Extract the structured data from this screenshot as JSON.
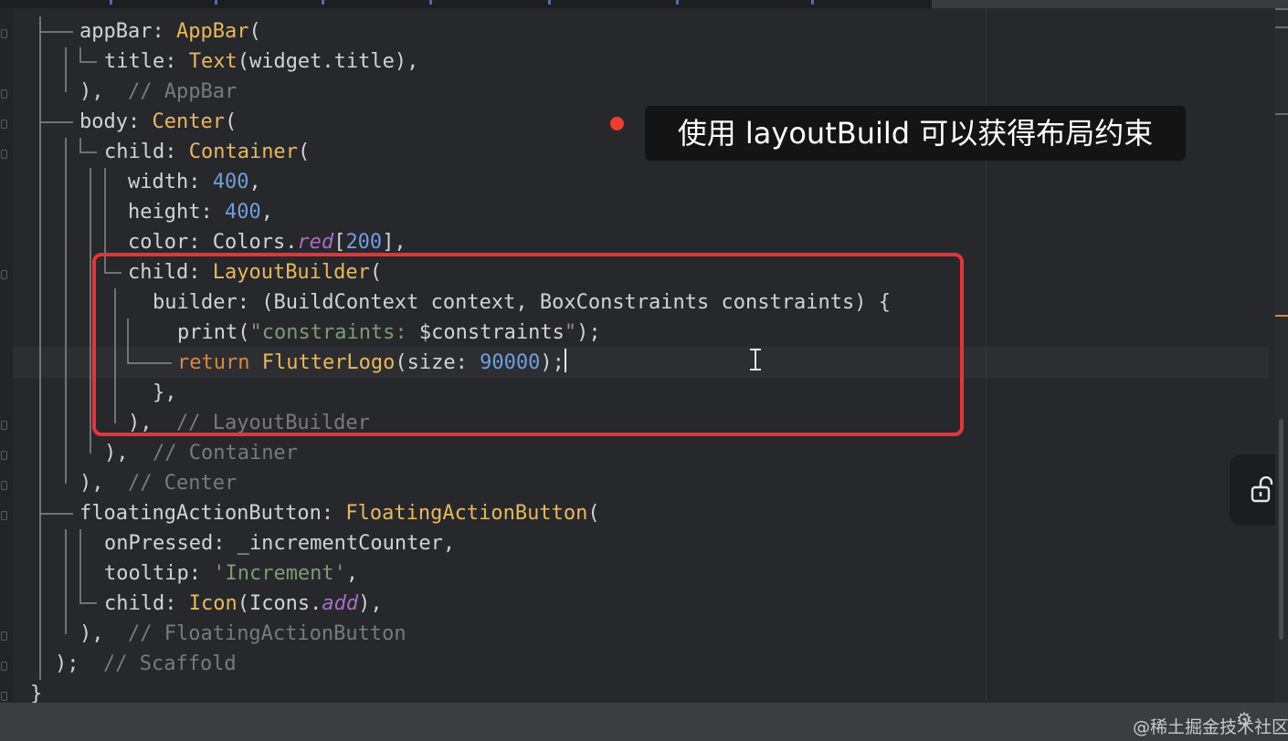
{
  "editor": {
    "lines": [
      [
        {
          "t": "appBar: ",
          "c": "k"
        },
        {
          "t": "AppBar",
          "c": "c"
        },
        {
          "t": "(",
          "c": "p"
        }
      ],
      [
        {
          "t": "title: ",
          "c": "k"
        },
        {
          "t": "Text",
          "c": "c"
        },
        {
          "t": "(",
          "c": "p"
        },
        {
          "t": "widget.title",
          "c": "k"
        },
        {
          "t": "),",
          "c": "p"
        }
      ],
      [
        {
          "t": "),  ",
          "c": "p"
        },
        {
          "t": "// AppBar",
          "c": "cm"
        }
      ],
      [
        {
          "t": "body: ",
          "c": "k"
        },
        {
          "t": "Center",
          "c": "c"
        },
        {
          "t": "(",
          "c": "p"
        }
      ],
      [
        {
          "t": "child: ",
          "c": "k"
        },
        {
          "t": "Container",
          "c": "c"
        },
        {
          "t": "(",
          "c": "p"
        }
      ],
      [
        {
          "t": "width: ",
          "c": "k"
        },
        {
          "t": "400",
          "c": "n"
        },
        {
          "t": ",",
          "c": "p"
        }
      ],
      [
        {
          "t": "height: ",
          "c": "k"
        },
        {
          "t": "400",
          "c": "n"
        },
        {
          "t": ",",
          "c": "p"
        }
      ],
      [
        {
          "t": "color: ",
          "c": "k"
        },
        {
          "t": "Colors.",
          "c": "k"
        },
        {
          "t": "red",
          "c": "i"
        },
        {
          "t": "[",
          "c": "p"
        },
        {
          "t": "200",
          "c": "n"
        },
        {
          "t": "],",
          "c": "p"
        }
      ],
      [
        {
          "t": "child: ",
          "c": "k"
        },
        {
          "t": "LayoutBuilder",
          "c": "c"
        },
        {
          "t": "(",
          "c": "p"
        }
      ],
      [
        {
          "t": "builder: (BuildContext context, BoxConstraints constraints) {",
          "c": "k"
        }
      ],
      [
        {
          "t": "print",
          "c": "k"
        },
        {
          "t": "(",
          "c": "p"
        },
        {
          "t": "\"constraints: ",
          "c": "s"
        },
        {
          "t": "$constraints",
          "c": "k"
        },
        {
          "t": "\"",
          "c": "s"
        },
        {
          "t": ");",
          "c": "p"
        }
      ],
      [
        {
          "t": "return ",
          "c": "kw"
        },
        {
          "t": "FlutterLogo",
          "c": "c"
        },
        {
          "t": "(size: ",
          "c": "k"
        },
        {
          "t": "90000",
          "c": "n"
        },
        {
          "t": ");",
          "c": "p"
        }
      ],
      [
        {
          "t": "},",
          "c": "p"
        }
      ],
      [
        {
          "t": "),  ",
          "c": "p"
        },
        {
          "t": "// LayoutBuilder",
          "c": "cm"
        }
      ],
      [
        {
          "t": "),  ",
          "c": "p"
        },
        {
          "t": "// Container",
          "c": "cm"
        }
      ],
      [
        {
          "t": "),  ",
          "c": "p"
        },
        {
          "t": "// Center",
          "c": "cm"
        }
      ],
      [
        {
          "t": "floatingActionButton: ",
          "c": "k"
        },
        {
          "t": "FloatingActionButton",
          "c": "c"
        },
        {
          "t": "(",
          "c": "p"
        }
      ],
      [
        {
          "t": "onPressed: _incrementCounter,",
          "c": "k"
        }
      ],
      [
        {
          "t": "tooltip: ",
          "c": "k"
        },
        {
          "t": "'Increment'",
          "c": "s"
        },
        {
          "t": ",",
          "c": "p"
        }
      ],
      [
        {
          "t": "child: ",
          "c": "k"
        },
        {
          "t": "Icon",
          "c": "c"
        },
        {
          "t": "(Icons.",
          "c": "k"
        },
        {
          "t": "add",
          "c": "i"
        },
        {
          "t": "),",
          "c": "p"
        }
      ],
      [
        {
          "t": "),  ",
          "c": "p"
        },
        {
          "t": "// FloatingActionButton",
          "c": "cm"
        }
      ],
      [
        {
          "t": ");  ",
          "c": "p"
        },
        {
          "t": "// Scaffold",
          "c": "cm"
        }
      ],
      [
        {
          "t": "}",
          "c": "p"
        }
      ]
    ]
  },
  "annotation": {
    "tooltip_text": "使用 layoutBuild 可以获得布局约束"
  },
  "watermark": "@稀土掘金技术社区",
  "icons": {
    "lock": "unlock-icon",
    "settings": "gear-icon"
  },
  "colors": {
    "background": "#27282c",
    "highlight_border": "#e4343a",
    "annotation_dot": "#f33a2c",
    "class_name": "#e8b95a",
    "number": "#6f9ee0",
    "comment": "#787a80",
    "string": "#7c9c72",
    "keyword": "#d58a3e"
  }
}
